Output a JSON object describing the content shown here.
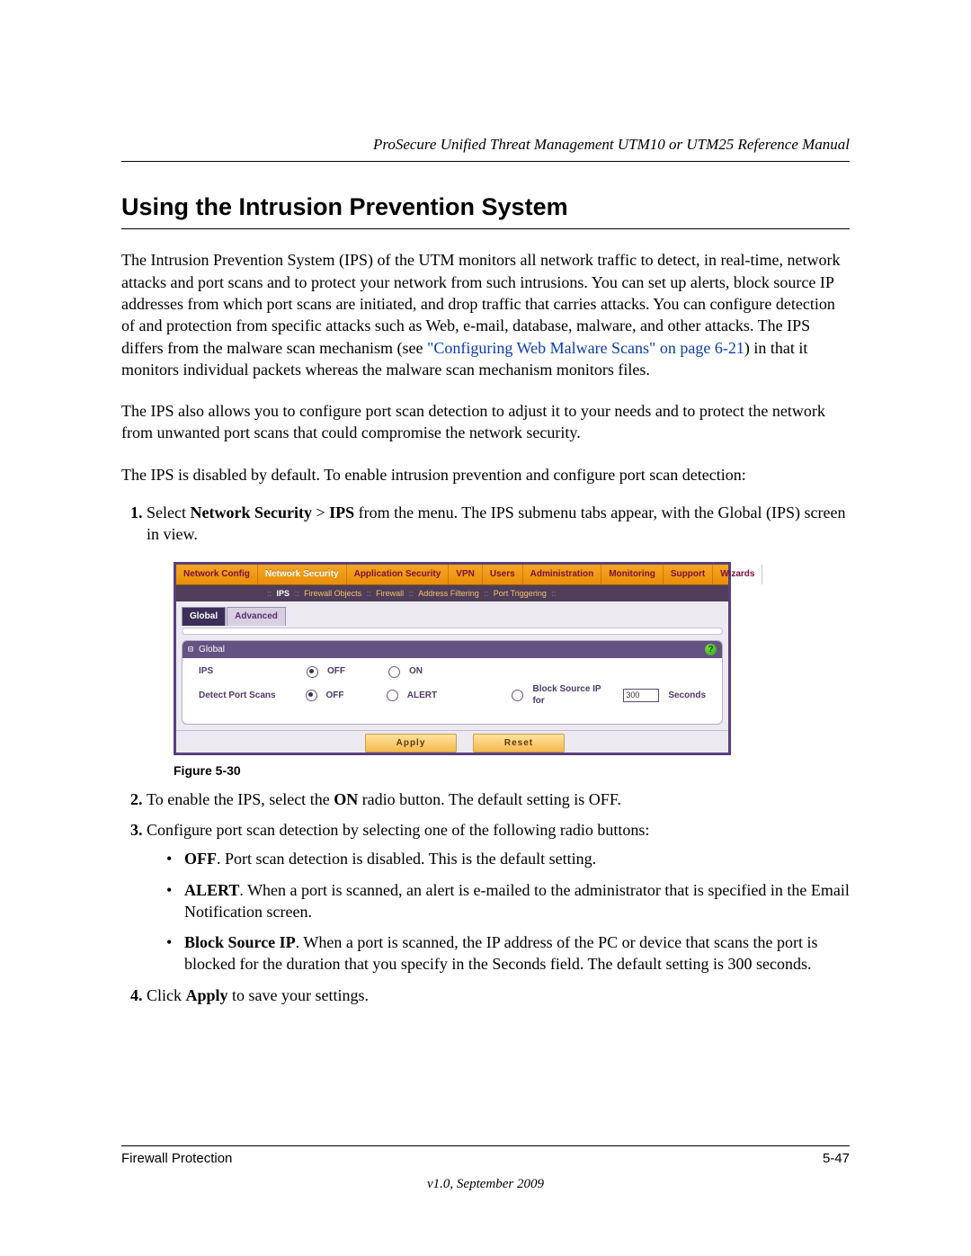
{
  "header": {
    "running": "ProSecure Unified Threat Management UTM10 or UTM25 Reference Manual"
  },
  "title": "Using the Intrusion Prevention System",
  "para1a": "The Intrusion Prevention System (IPS) of the UTM monitors all network traffic to detect, in real-time, network attacks and port scans and to protect your network from such intrusions. You can set up alerts, block source IP addresses from which port scans are initiated, and drop traffic that carries attacks. You can configure detection of and protection from specific attacks such as Web, e-mail, database, malware, and other attacks. The IPS differs from the malware scan mechanism (see ",
  "para1_link": "\"Configuring Web Malware Scans\" on page 6-21",
  "para1b": ") in that it monitors individual packets whereas the malware scan mechanism monitors files.",
  "para2": "The IPS also allows you to configure port scan detection to adjust it to your needs and to protect the network from unwanted port scans that could compromise the network security.",
  "para3": "The IPS is disabled by default. To enable intrusion prevention and configure port scan detection:",
  "step1a": "Select ",
  "step1_nav": "Network Security",
  "step1_sep": " > ",
  "step1_nav2": "IPS",
  "step1b": " from the menu. The IPS submenu tabs appear, with the Global (IPS) screen in view.",
  "figure": {
    "tabs": [
      "Network Config",
      "Network Security",
      "Application Security",
      "VPN",
      "Users",
      "Administration",
      "Monitoring",
      "Support",
      "Wizards"
    ],
    "subtabs": [
      "IPS",
      "Firewall Objects",
      "Firewall",
      "Address Filtering",
      "Port Triggering"
    ],
    "innertabs": [
      "Global",
      "Advanced"
    ],
    "panel_title": "Global",
    "row1": {
      "label": "IPS",
      "opt1": "OFF",
      "opt2": "ON"
    },
    "row2": {
      "label": "Detect Port Scans",
      "opt1": "OFF",
      "opt2": "ALERT",
      "opt3": "Block Source IP for",
      "seconds_val": "300",
      "seconds_lbl": "Seconds"
    },
    "apply": "Apply",
    "reset": "Reset",
    "help_glyph": "?"
  },
  "caption": "Figure 5-30",
  "step2a": "To enable the IPS, select the ",
  "step2_on": "ON",
  "step2b": " radio button. The default setting is OFF.",
  "step3": "Configure port scan detection by selecting one of the following radio buttons:",
  "bullets": {
    "off_b": "OFF",
    "off_t": ". Port scan detection is disabled. This is the default setting.",
    "alert_b": "ALERT",
    "alert_t": ". When a port is scanned, an alert is e-mailed to the administrator that is specified in the Email Notification screen.",
    "block_b": "Block Source IP",
    "block_t": ". When a port is scanned, the IP address of the PC or device that scans the port is blocked for the duration that you specify in the Seconds field. The default setting is 300 seconds."
  },
  "step4a": "Click ",
  "step4_b": "Apply",
  "step4b": " to save your settings.",
  "footer": {
    "left": "Firewall Protection",
    "right": "5-47",
    "center": "v1.0, September 2009"
  }
}
